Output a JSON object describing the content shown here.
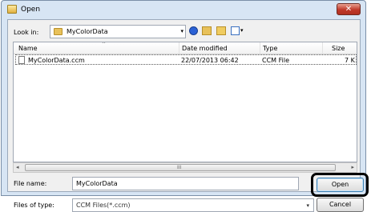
{
  "window": {
    "title": "Open",
    "close_label": "✕"
  },
  "toolbar": {
    "lookin_label": "Look in:",
    "lookin_value": "MyColorData",
    "combo_arrow": "▾"
  },
  "list": {
    "columns": [
      "Name",
      "Date modified",
      "Type",
      "Size"
    ],
    "sort_indicator": "^",
    "rows": [
      {
        "name": "MyColorData.ccm",
        "date": "22/07/2013 06:42",
        "type": "CCM File",
        "size": "7 K"
      }
    ]
  },
  "scrollbar": {
    "left_arrow": "◂",
    "right_arrow": "▸",
    "grip": "III"
  },
  "form": {
    "filename_label": "File name:",
    "filename_value": "MyColorData",
    "filetype_label": "Files of type:",
    "filetype_value": "CCM Files(*.ccm)",
    "open_label": "Open",
    "cancel_label": "Cancel"
  },
  "colors": {
    "frame": "#d7e5f4",
    "close_button": "#c0392b",
    "highlight_outline": "#000000"
  }
}
